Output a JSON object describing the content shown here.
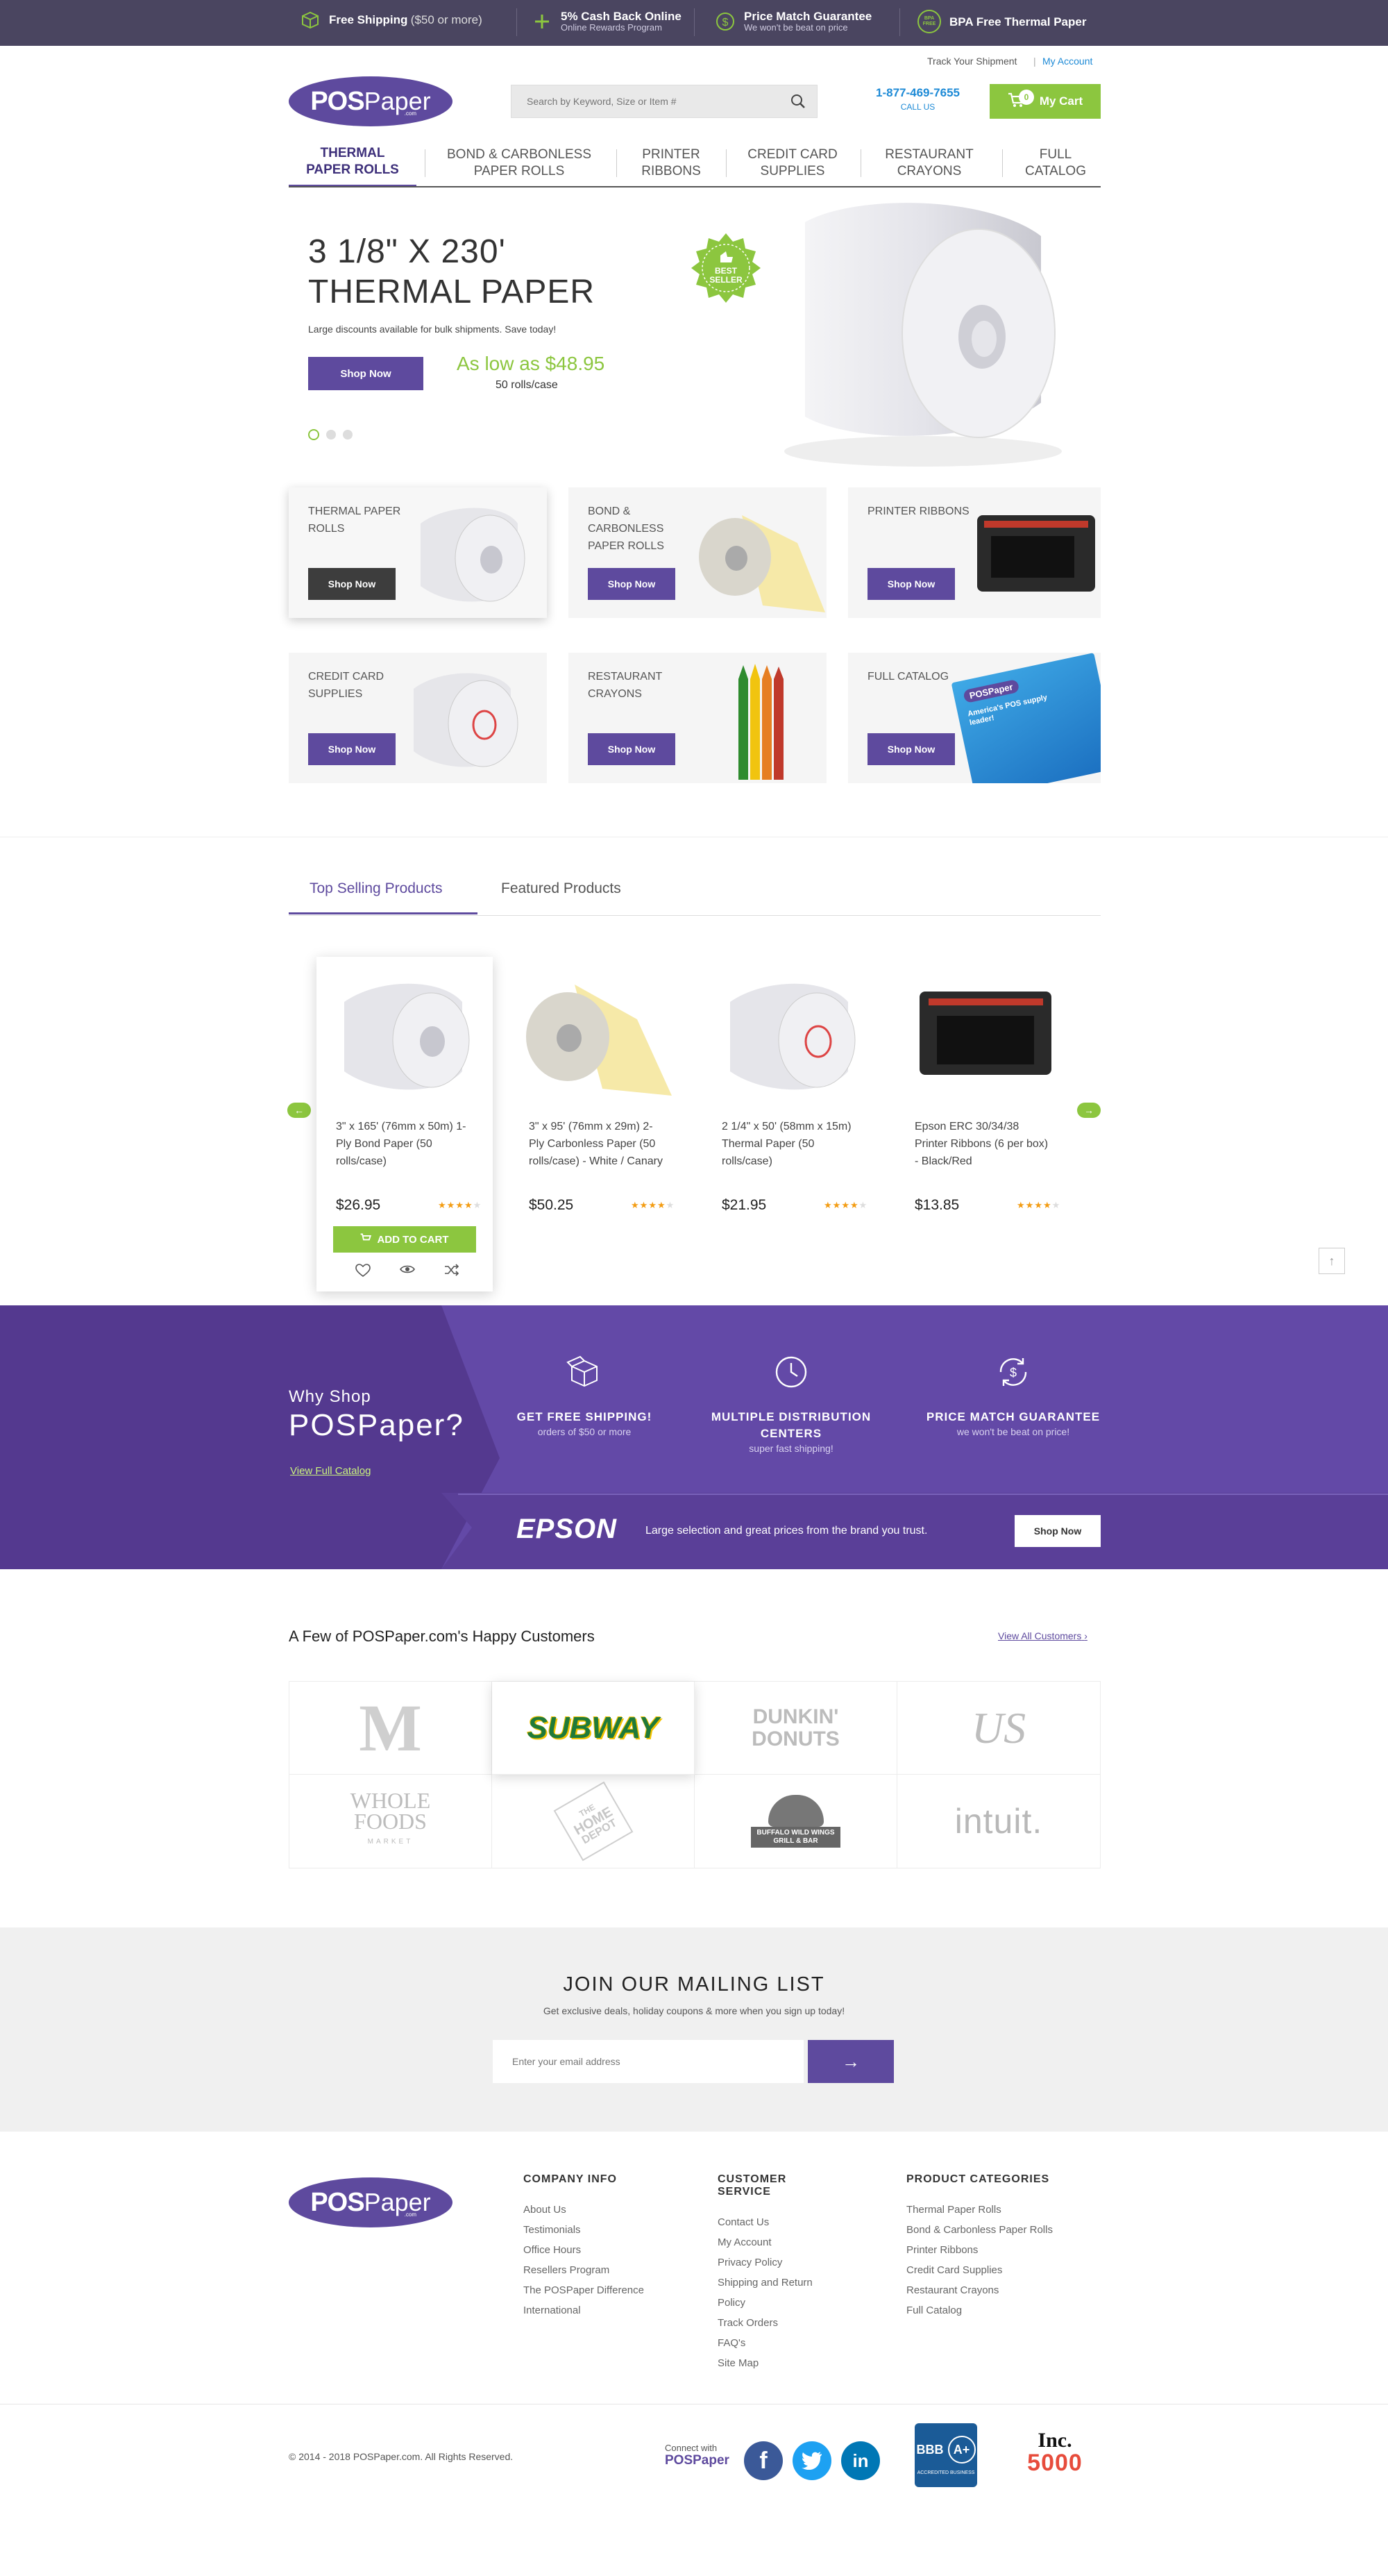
{
  "topbar": {
    "items": [
      {
        "main": "Free Shipping",
        "sub": "($50 or more)",
        "icon": "box-icon"
      },
      {
        "main": "5% Cash Back Online",
        "sub": "Online Rewards Program",
        "icon": "plus-icon"
      },
      {
        "main": "Price Match Guarantee",
        "sub": "We won't be beat on price",
        "icon": "dollar-icon"
      },
      {
        "main": "BPA Free Thermal Paper",
        "sub": "",
        "icon": "bpa-free-icon",
        "icon_text": "BPA FREE"
      }
    ]
  },
  "header": {
    "track": "Track Your Shipment",
    "account": "My Account",
    "logo_pos": "POS",
    "logo_paper": "Paper",
    "logo_com": ".com",
    "search_placeholder": "Search by Keyword, Size or Item #",
    "phone": "1-877-469-7655",
    "call_us": "CALL US",
    "cart_label": "My Cart",
    "cart_count": "0"
  },
  "nav": [
    {
      "line1": "THERMAL",
      "line2": "PAPER ROLLS",
      "active": true
    },
    {
      "line1": "BOND & CARBONLESS",
      "line2": "PAPER ROLLS"
    },
    {
      "line1": "PRINTER",
      "line2": "RIBBONS"
    },
    {
      "line1": "CREDIT CARD",
      "line2": "SUPPLIES"
    },
    {
      "line1": "RESTAURANT",
      "line2": "CRAYONS"
    },
    {
      "line1": "FULL",
      "line2": "CATALOG"
    }
  ],
  "hero": {
    "title1": "3 1/8\" X 230'",
    "title2": "THERMAL PAPER",
    "subtitle": "Large discounts available for bulk shipments. Save today!",
    "button": "Shop Now",
    "price_prefix": "As low as",
    "price": "$48.95",
    "unit": "50 rolls/case",
    "badge_line1": "BEST",
    "badge_line2": "SELLER"
  },
  "categories": [
    {
      "label": "THERMAL PAPER ROLLS",
      "button": "Shop Now"
    },
    {
      "label": "BOND & CARBONLESS PAPER ROLLS",
      "button": "Shop Now"
    },
    {
      "label": "PRINTER RIBBONS",
      "button": "Shop Now"
    },
    {
      "label": "CREDIT CARD SUPPLIES",
      "button": "Shop Now"
    },
    {
      "label": "RESTAURANT CRAYONS",
      "button": "Shop Now"
    },
    {
      "label": "FULL CATALOG",
      "button": "Shop Now",
      "catalog_brand": "POSPaper",
      "catalog_text": "America's POS supply leader!"
    }
  ],
  "tabs": {
    "top_selling": "Top Selling Products",
    "featured": "Featured Products"
  },
  "products": [
    {
      "name": "3\" x 165' (76mm x 50m) 1-Ply Bond Paper (50 rolls/case)",
      "price": "$26.95",
      "stars": "★★★★★",
      "rating": 4
    },
    {
      "name": "3\" x 95' (76mm x 29m) 2-Ply Carbonless Paper (50 rolls/case) - White / Canary",
      "price": "$50.25",
      "stars": "★★★★★",
      "rating": 4
    },
    {
      "name": "2 1/4\" x 50' (58mm x 15m) Thermal Paper (50 rolls/case)",
      "price": "$21.95",
      "stars": "★★★★★",
      "rating": 4
    },
    {
      "name": "Epson ERC 30/34/38 Printer Ribbons (6 per box) - Black/Red",
      "price": "$13.85",
      "stars": "★★★★★",
      "rating": 4
    }
  ],
  "add_to_cart": "ADD TO CART",
  "why": {
    "small": "Why Shop",
    "big": "POSPaper?",
    "link": "View Full Catalog",
    "features": [
      {
        "title1": "GET FREE SHIPPING!",
        "title2": "",
        "sub": "orders of $50 or more",
        "icon": "open-box-icon"
      },
      {
        "title1": "MULTIPLE DISTRIBUTION",
        "title2": "CENTERS",
        "sub": "super fast shipping!",
        "icon": "clock-icon"
      },
      {
        "title1": "PRICE MATCH GUARANTEE",
        "title2": "",
        "sub": "we won't be beat on price!",
        "icon": "dollar-cycle-icon"
      }
    ],
    "epson_logo": "EPSON",
    "epson_text": "Large selection and great prices from the brand you trust.",
    "epson_button": "Shop Now"
  },
  "customers": {
    "title": "A Few of POSPaper.com's Happy Customers",
    "view_all": "View All Customers",
    "logos": [
      {
        "name": "mcdonalds-logo",
        "text": "M"
      },
      {
        "name": "subway-logo",
        "text": "SUBWAY"
      },
      {
        "name": "dunkin-donuts-logo",
        "text1": "DUNKIN'",
        "text2": "DONUTS"
      },
      {
        "name": "us-airways-logo",
        "text": "US"
      },
      {
        "name": "whole-foods-logo",
        "text1": "WHOLE",
        "text2": "FOODS",
        "text3": "MARKET"
      },
      {
        "name": "home-depot-logo",
        "text1": "THE",
        "text2": "HOME",
        "text3": "DEPOT"
      },
      {
        "name": "buffalo-wild-wings-logo",
        "text1": "BUFFALO WILD WINGS",
        "text2": "GRILL & BAR"
      },
      {
        "name": "intuit-logo",
        "text": "intuit."
      }
    ]
  },
  "mailing": {
    "title": "JOIN OUR MAILING LIST",
    "subtitle": "Get exclusive deals, holiday coupons & more when you sign up today!",
    "placeholder": "Enter your email address",
    "arrow": "→"
  },
  "footer": {
    "company": {
      "title": "COMPANY INFO",
      "links": [
        "About Us",
        "Testimonials",
        "Office Hours",
        "Resellers Program",
        "The POSPaper Difference",
        "International"
      ]
    },
    "service": {
      "title": "CUSTOMER SERVICE",
      "links": [
        "Contact Us",
        "My Account",
        "Privacy Policy",
        "Shipping and Return Policy",
        "Track Orders",
        "FAQ's",
        "Site Map"
      ]
    },
    "categories": {
      "title": "PRODUCT CATEGORIES",
      "links": [
        "Thermal Paper Rolls",
        "Bond & Carbonless Paper Rolls",
        "Printer Ribbons",
        "Credit Card Supplies",
        "Restaurant Crayons",
        "Full Catalog"
      ]
    },
    "copyright": "© 2014 - 2018 POSPaper.com. All Rights Reserved.",
    "connect": "Connect with",
    "connect_brand": "POSPaper",
    "bbb": "BBB",
    "bbb_rating": "A+",
    "bbb_sub": "ACCREDITED BUSINESS",
    "inc": "Inc.",
    "inc_number": "5000"
  },
  "colors": {
    "purple": "#5e4a9e",
    "green": "#8cc63f",
    "topbar": "#4a4560",
    "why_band": "#6349a7",
    "phone": "#1d8ad6"
  }
}
